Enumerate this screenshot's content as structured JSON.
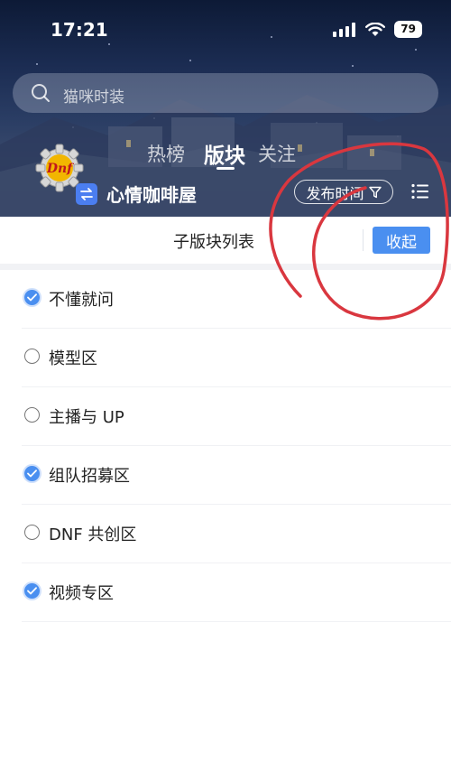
{
  "status_bar": {
    "time": "17:21",
    "battery": "79"
  },
  "search": {
    "placeholder": "猫咪时装"
  },
  "tabs": [
    {
      "label": "热榜",
      "active": false
    },
    {
      "label": "版块",
      "active": true
    },
    {
      "label": "关注",
      "active": false
    }
  ],
  "board": {
    "name": "心情咖啡屋",
    "logo_text": "Dnf"
  },
  "toolbar": {
    "sort_label": "发布时间"
  },
  "sub_boards": {
    "title": "子版块列表",
    "collapse_label": "收起",
    "items": [
      {
        "label": "不懂就问",
        "checked": true
      },
      {
        "label": "模型区",
        "checked": false
      },
      {
        "label": "主播与 UP",
        "checked": false
      },
      {
        "label": "组队招募区",
        "checked": true
      },
      {
        "label": "DNF 共创区",
        "checked": false
      },
      {
        "label": "视频专区",
        "checked": true
      }
    ]
  },
  "colors": {
    "accent": "#4a8ff0",
    "annotation": "#d9373f"
  }
}
